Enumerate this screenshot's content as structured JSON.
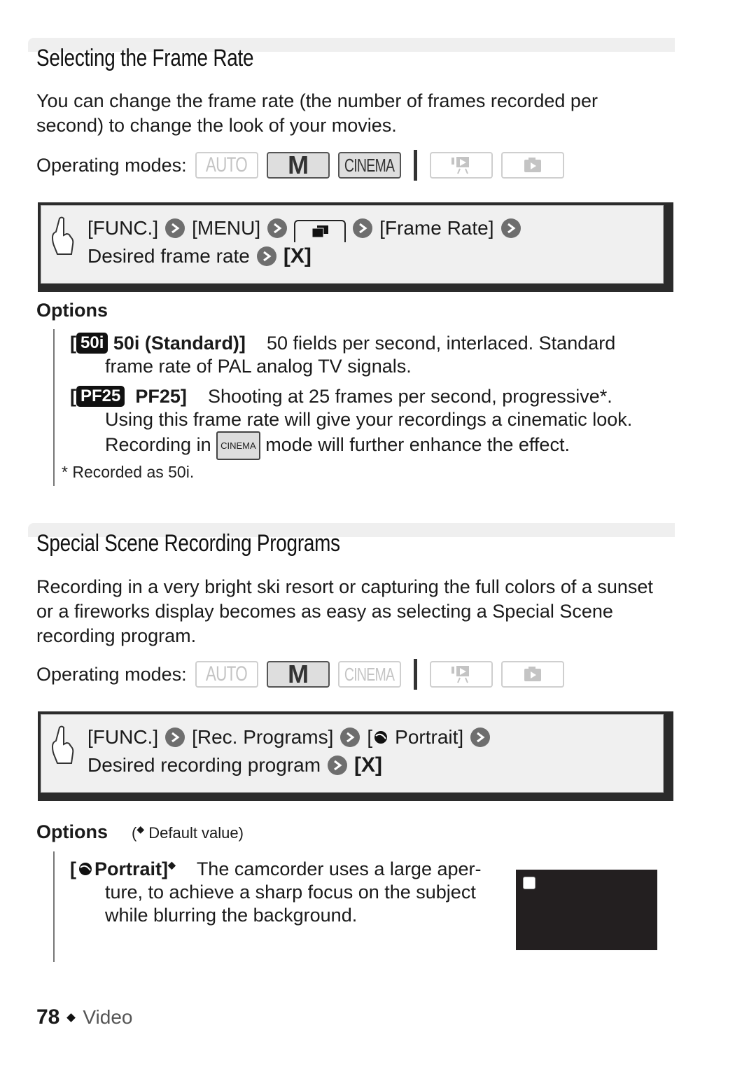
{
  "section1": {
    "title": "Selecting the Frame Rate",
    "intro": "You can change the frame rate (the number of frames recorded per second) to change the look of your movies.",
    "operating_modes_label": "Operating modes:",
    "modes": [
      {
        "label": "AUTO",
        "state": "inactive"
      },
      {
        "label": "M",
        "state": "active"
      },
      {
        "label": "CINEMA",
        "state": "active"
      },
      {
        "icon": "movie-playback-icon",
        "state": "inactive"
      },
      {
        "icon": "photo-playback-icon",
        "state": "inactive"
      }
    ],
    "procedure": {
      "line1": [
        "[FUNC.]",
        "[MENU]",
        "movie-menu-tab-icon",
        "[Frame Rate]"
      ],
      "line2": [
        "Desired frame rate",
        "[X]"
      ]
    },
    "options_heading": "Options",
    "options": [
      {
        "tag": "50i",
        "name": "50i (Standard)]",
        "desc_first": "50 fields per second, interlaced. Standard",
        "desc_rest": "frame rate of PAL analog TV signals."
      },
      {
        "tag": "PF25",
        "name": "PF25]",
        "desc_first": "Shooting at 25 frames per second, progressive*.",
        "desc_rest_1": "Using this frame rate will give your recordings a cinematic look.",
        "desc_rest_2a": "Recording in",
        "inline_mode": "CINEMA",
        "desc_rest_2b": "mode will further enhance the effect."
      }
    ],
    "footnote": "*  Recorded as 50i."
  },
  "section2": {
    "title": "Special Scene Recording Programs",
    "intro": "Recording in a very bright ski resort or capturing the full colors of a sunset or a fireworks display becomes as easy as selecting a Special Scene recording program.",
    "operating_modes_label": "Operating modes:",
    "modes": [
      {
        "label": "AUTO",
        "state": "inactive"
      },
      {
        "label": "M",
        "state": "active"
      },
      {
        "label": "CINEMA",
        "state": "inactive"
      },
      {
        "icon": "movie-playback-icon",
        "state": "inactive"
      },
      {
        "icon": "photo-playback-icon",
        "state": "inactive"
      }
    ],
    "procedure": {
      "line1": [
        "[FUNC.]",
        "[Rec. Programs]",
        "[",
        "Portrait]"
      ],
      "line2": [
        "Desired recording program",
        "[X]"
      ]
    },
    "options_heading": "Options",
    "options_note": "Default value)",
    "options": [
      {
        "name": "Portrait]",
        "default": true,
        "desc_first": "The camcorder uses a large aper-",
        "desc_rest_1": "ture, to achieve a sharp focus on the subject",
        "desc_rest_2": "while blurring the background."
      }
    ]
  },
  "footer": {
    "page_number": "78",
    "section": "Video"
  },
  "colors": {
    "accent_dark": "#2b2b2b",
    "box_bg": "#f0f0f0",
    "arrow": "#6e6e6e",
    "preview_bg": "#231f20"
  }
}
